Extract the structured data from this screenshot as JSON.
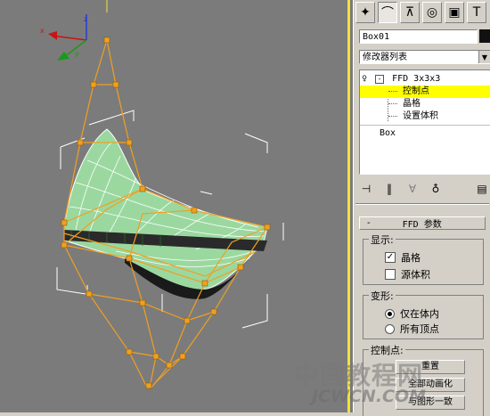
{
  "viewport": {
    "name": "Perspective viewport",
    "colors": {
      "background": "#7b7b7b",
      "lattice": "#f0a020",
      "mesh_fill": "#9bd8a0",
      "border": "#f0e33a"
    },
    "gizmo_icons": [
      "axis-tripod-icon"
    ]
  },
  "command_panel": {
    "tabs": [
      {
        "name": "create-tab",
        "glyph": "✦"
      },
      {
        "name": "modify-tab",
        "glyph": "⌒"
      },
      {
        "name": "hierarchy-tab",
        "glyph": "⊼"
      },
      {
        "name": "motion-tab",
        "glyph": "◎"
      },
      {
        "name": "display-tab",
        "glyph": "▣"
      },
      {
        "name": "utilities-tab",
        "glyph": "T"
      }
    ],
    "object_name": "Box01",
    "object_color": "#111111",
    "modifier_list": "修改器列表",
    "stack": {
      "ffd": "FFD 3x3x3",
      "control_points": "控制点",
      "lattice": "晶格",
      "set_volume": "设置体积",
      "box": "Box"
    },
    "rollout": {
      "title": "FFD 参数",
      "collapse": "-",
      "display_group": "显示:",
      "lattice_checkbox": "晶格",
      "lattice_checked": true,
      "source_volume_checkbox": "源体积",
      "source_volume_checked": false,
      "deform_group": "变形:",
      "only_in_volume": "仅在体内",
      "all_vertices": "所有顶点",
      "control_points_group": "控制点:",
      "reset_button": "重置",
      "animate_all_button": "全部动画化",
      "conform_button": "与图形一致"
    }
  },
  "watermark": {
    "cn": "中国教程网",
    "en": "JCWCN.COM"
  }
}
